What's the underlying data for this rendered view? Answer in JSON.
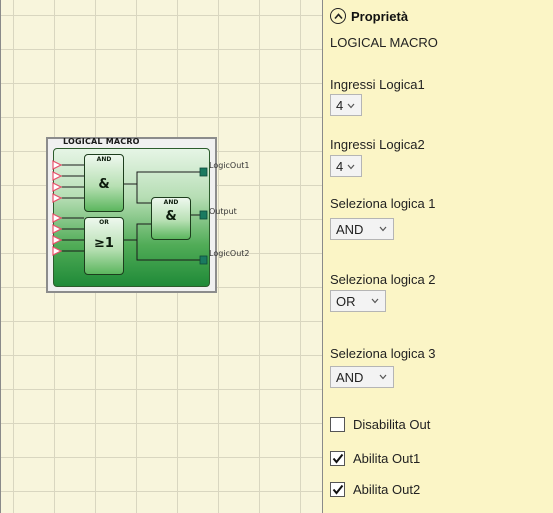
{
  "canvas": {
    "block": {
      "title": "LOGICAL MACRO",
      "gate1": {
        "tag": "AND",
        "symbol": "&"
      },
      "gate2": {
        "tag": "OR",
        "symbol": "≥1"
      },
      "gate3": {
        "tag": "AND",
        "symbol": "&"
      },
      "outputs": [
        "LogicOut1",
        "Output",
        "LogicOut2"
      ],
      "input_count": 8
    }
  },
  "panel": {
    "title": "Proprietà",
    "collapse_icon": "chevron-up-circle-icon",
    "subtitle": "LOGICAL MACRO",
    "fields": [
      {
        "label": "Ingressi Logica1",
        "value": "4"
      },
      {
        "label": "Ingressi Logica2",
        "value": "4"
      },
      {
        "label": "Seleziona logica 1",
        "value": "AND"
      },
      {
        "label": "Seleziona logica 2",
        "value": "OR"
      },
      {
        "label": "Seleziona logica 3",
        "value": "AND"
      }
    ],
    "checkboxes": [
      {
        "label": "Disabilita Out",
        "checked": false
      },
      {
        "label": "Abilita Out1",
        "checked": true
      },
      {
        "label": "Abilita Out2",
        "checked": true
      }
    ]
  },
  "colors": {
    "canvas_bg": "#f8f5dc",
    "panel_bg": "#fbf5c6",
    "block_green": "#1f8a38",
    "input_pin": "#e8506a",
    "output_pin": "#1a7a60"
  }
}
